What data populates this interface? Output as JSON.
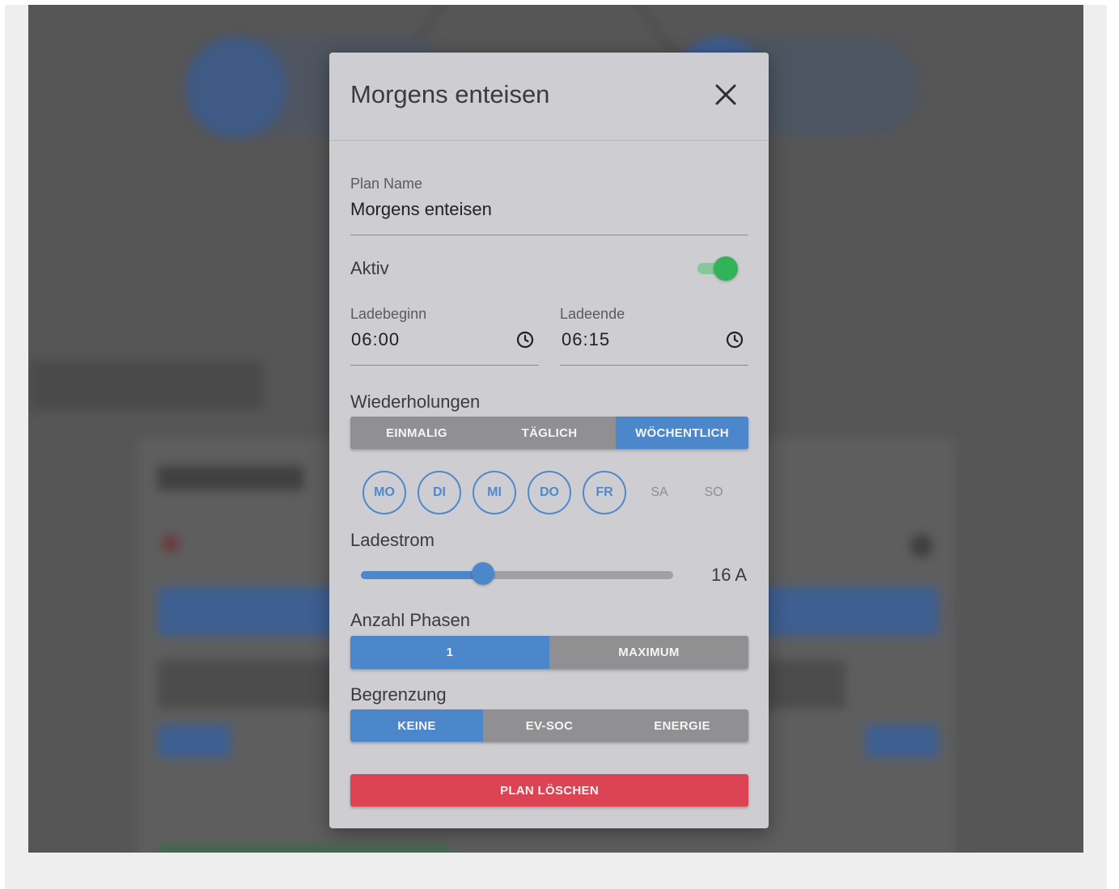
{
  "modal": {
    "title": "Morgens enteisen",
    "close_icon": "close-icon"
  },
  "form": {
    "plan_name_label": "Plan Name",
    "plan_name_value": "Morgens enteisen",
    "active_label": "Aktiv",
    "active_on": true,
    "start_label": "Ladebeginn",
    "start_value": "06:00",
    "end_label": "Ladeende",
    "end_value": "06:15",
    "repeat_label": "Wiederholungen",
    "repeat_options": [
      "EINMALIG",
      "TÄGLICH",
      "WÖCHENTLICH"
    ],
    "repeat_selected": "WÖCHENTLICH",
    "days": [
      {
        "label": "MO",
        "selected": true
      },
      {
        "label": "DI",
        "selected": true
      },
      {
        "label": "MI",
        "selected": true
      },
      {
        "label": "DO",
        "selected": true
      },
      {
        "label": "FR",
        "selected": true
      },
      {
        "label": "SA",
        "selected": false
      },
      {
        "label": "SO",
        "selected": false
      }
    ],
    "current_label": "Ladestrom",
    "current_value": "16 A",
    "current_fraction": 0.39,
    "phases_label": "Anzahl Phasen",
    "phases_options": [
      "1",
      "MAXIMUM"
    ],
    "phases_selected": "1",
    "limit_label": "Begrenzung",
    "limit_options": [
      "KEINE",
      "EV-SOC",
      "ENERGIE"
    ],
    "limit_selected": "KEINE",
    "delete_label": "PLAN LÖSCHEN"
  },
  "colors": {
    "accent": "#4d87cb",
    "toggle_on": "#2fb45a",
    "danger": "#dc4454"
  }
}
